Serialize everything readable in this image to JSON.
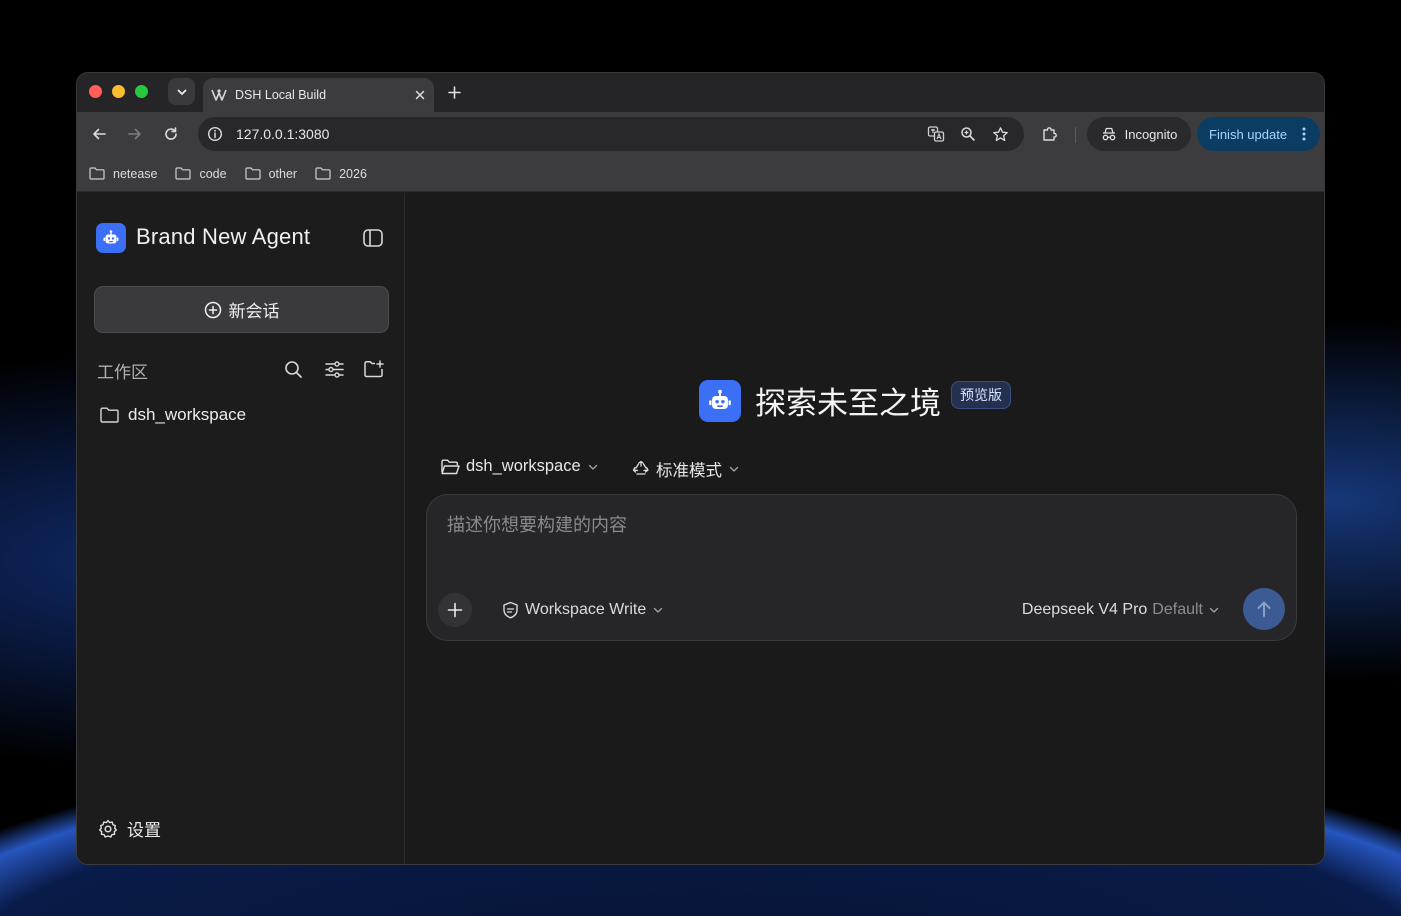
{
  "browser": {
    "tab_title": "DSH Local Build",
    "url": "127.0.0.1:3080",
    "incognito_label": "Incognito",
    "finish_update_label": "Finish update",
    "bookmarks": [
      "netease",
      "code",
      "other",
      "2026"
    ]
  },
  "sidebar": {
    "brand": "Brand New Agent",
    "new_chat_label": "新会话",
    "workspace_label": "工作区",
    "workspaces": [
      "dsh_workspace"
    ],
    "settings_label": "设置"
  },
  "main": {
    "hero_title": "探索未至之境",
    "hero_badge": "预览版",
    "workspace_selector": "dsh_workspace",
    "mode_selector": "标准模式",
    "composer_placeholder": "描述你想要构建的内容",
    "permission_label": "Workspace Write",
    "model_name": "Deepseek V4 Pro",
    "model_variant": "Default"
  },
  "colors": {
    "accent": "#3b6ff5",
    "send_button": "#3c5a94",
    "finish_update_bg": "#0b3c62"
  }
}
